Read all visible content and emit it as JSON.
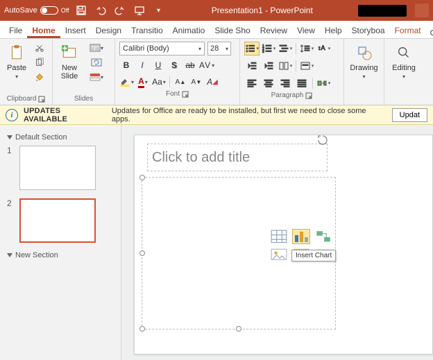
{
  "titlebar": {
    "autosave_label": "AutoSave",
    "autosave_state": "Off",
    "doc_title": "Presentation1 - PowerPoint"
  },
  "tabs": {
    "items": [
      "File",
      "Home",
      "Insert",
      "Design",
      "Transitio",
      "Animatio",
      "Slide Sho",
      "Review",
      "View",
      "Help",
      "Storyboa",
      "Format"
    ],
    "active_index": 1
  },
  "ribbon": {
    "clipboard": {
      "label": "Clipboard",
      "paste": "Paste"
    },
    "slides": {
      "label": "Slides",
      "new_slide": "New\nSlide"
    },
    "font": {
      "label": "Font",
      "name": "Calibri (Body)",
      "size": "28"
    },
    "paragraph": {
      "label": "Paragraph"
    },
    "drawing": {
      "label": "Drawing",
      "btn": "Drawing"
    },
    "editing": {
      "label": "Editing",
      "btn": "Editing"
    }
  },
  "notify": {
    "title": "UPDATES AVAILABLE",
    "msg": "Updates for Office are ready to be installed, but first we need to close some apps.",
    "btn": "Updat"
  },
  "thumbs": {
    "section1": "Default Section",
    "section2": "New Section",
    "nums": [
      "1",
      "2"
    ]
  },
  "slide": {
    "title_placeholder": "Click to add title",
    "tooltip": "Insert Chart"
  }
}
